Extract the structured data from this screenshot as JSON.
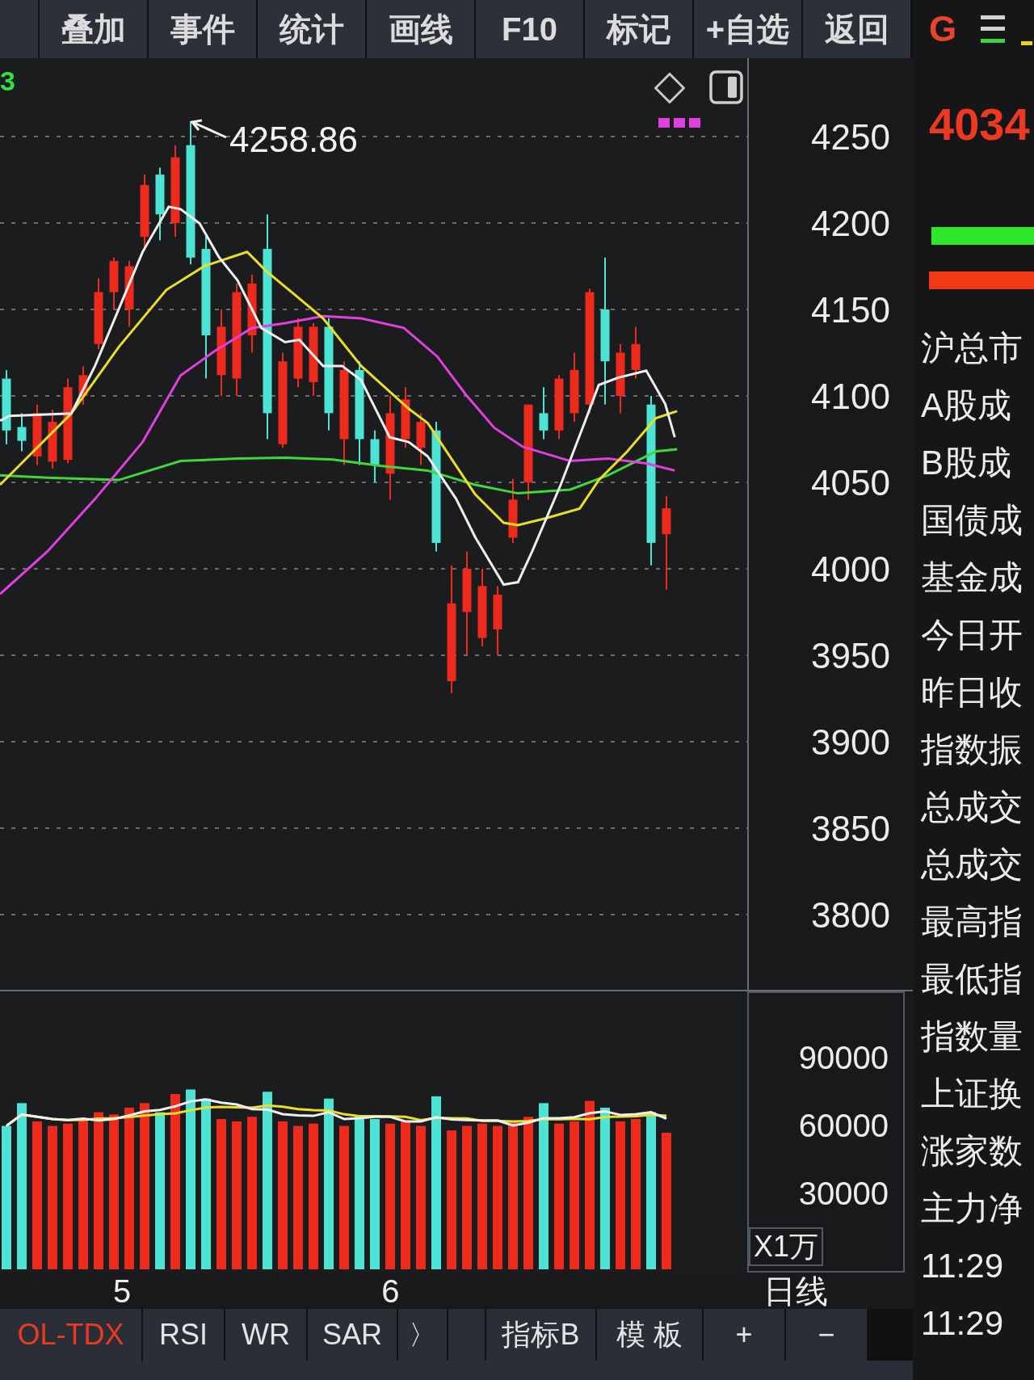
{
  "toolbar": {
    "buttons": [
      "叠加",
      "事件",
      "统计",
      "画线",
      "F10",
      "标记",
      "+自选",
      "返回"
    ]
  },
  "chart": {
    "corner_label": "3",
    "high_label": "4258.86",
    "y_ticks": [
      "4250",
      "4200",
      "4150",
      "4100",
      "4050",
      "4000",
      "3950",
      "3900",
      "3850",
      "3800"
    ]
  },
  "volume": {
    "y_ticks": [
      "90000",
      "60000",
      "30000"
    ],
    "unit": "X1万"
  },
  "x_labels": [
    "5",
    "6"
  ],
  "period": "日线",
  "indicator_tabs": [
    {
      "label": "OL-TDX",
      "selected": true
    },
    {
      "label": "RSI",
      "selected": false
    },
    {
      "label": "WR",
      "selected": false
    },
    {
      "label": "SAR",
      "selected": false
    }
  ],
  "next_arrow": "〉",
  "bottom_buttons": [
    "指标B",
    "模 板",
    "+",
    "−"
  ],
  "side_panel": {
    "mode": "G",
    "price": "4034",
    "rows": [
      "沪总市",
      "A股成",
      "B股成",
      "国债成",
      "基金成",
      "今日开",
      "昨日收",
      "指数振",
      "总成交",
      "总成交",
      "最高指",
      "最低指",
      "指数量",
      "上证换",
      "涨家数",
      "主力净",
      "11:29",
      "11:29"
    ]
  }
}
